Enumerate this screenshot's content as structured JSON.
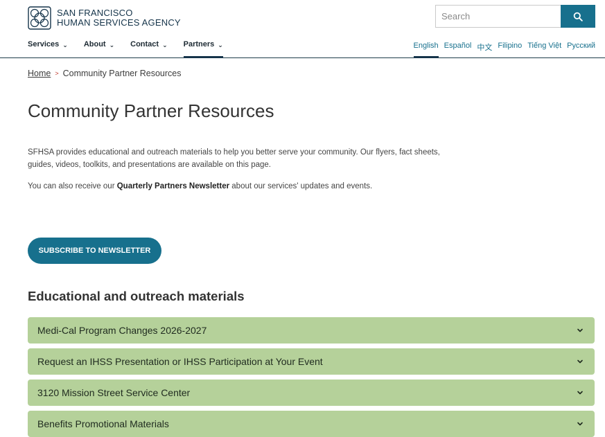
{
  "header": {
    "logo_line1": "SAN FRANCISCO",
    "logo_line2": "HUMAN SERVICES AGENCY",
    "search_placeholder": "Search",
    "nav": [
      {
        "label": "Services"
      },
      {
        "label": "About"
      },
      {
        "label": "Contact"
      },
      {
        "label": "Partners"
      }
    ],
    "active_nav": "Partners",
    "languages": [
      "English",
      "Español",
      "中文",
      "Filipino",
      "Tiếng Việt",
      "Русский"
    ],
    "active_language": "English"
  },
  "breadcrumb": {
    "home": "Home",
    "separator": ">",
    "current": "Community Partner Resources"
  },
  "page": {
    "title": "Community Partner Resources",
    "intro": "SFHSA provides educational and outreach materials to help you better serve your community. Our flyers, fact sheets, guides, videos, toolkits, and presentations are available on this page.",
    "newsletter_prefix": "You can also receive our ",
    "newsletter_bold": "Quarterly Partners Newsletter",
    "newsletter_suffix": " about our services' updates and events.",
    "subscribe_label": "SUBSCRIBE TO NEWSLETTER",
    "section_title": "Educational and outreach materials",
    "accordions": [
      {
        "label": "Medi-Cal Program Changes 2026-2027"
      },
      {
        "label": "Request an IHSS Presentation or IHSS Participation at Your Event"
      },
      {
        "label": "3120 Mission Street Service Center"
      },
      {
        "label": "Benefits Promotional Materials"
      }
    ]
  },
  "colors": {
    "brand_blue": "#17708d",
    "navy": "#15344a",
    "accordion_green": "#b5d19a"
  }
}
